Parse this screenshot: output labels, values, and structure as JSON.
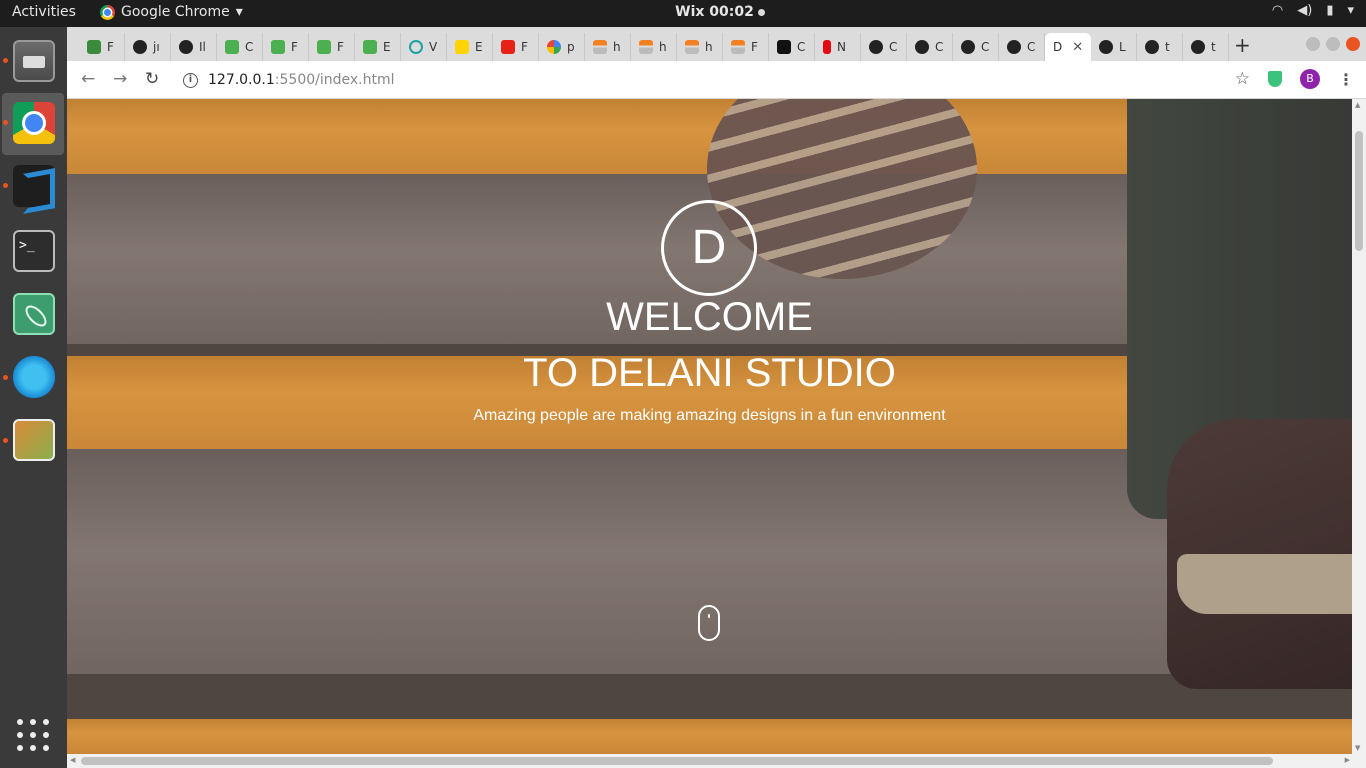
{
  "topbar": {
    "activities": "Activities",
    "app_name": "Google Chrome",
    "app_caret": "▾",
    "clock": "Wix 00:02"
  },
  "browser": {
    "tabs": [
      {
        "title": "F",
        "favicon": "green-leaf-icon"
      },
      {
        "title": "jı",
        "favicon": "github-icon"
      },
      {
        "title": "Il",
        "favicon": "github-icon"
      },
      {
        "title": "C",
        "favicon": "w3schools-icon"
      },
      {
        "title": "F",
        "favicon": "w3schools-icon"
      },
      {
        "title": "F",
        "favicon": "w3schools-icon"
      },
      {
        "title": "E",
        "favicon": "w3schools-icon"
      },
      {
        "title": "V",
        "favicon": "ring-icon"
      },
      {
        "title": "E",
        "favicon": "yellow-app-icon"
      },
      {
        "title": "F",
        "favicon": "youtube-icon"
      },
      {
        "title": "p",
        "favicon": "google-icon"
      },
      {
        "title": "h",
        "favicon": "stackoverflow-icon"
      },
      {
        "title": "h",
        "favicon": "stackoverflow-icon"
      },
      {
        "title": "h",
        "favicon": "stackoverflow-icon"
      },
      {
        "title": "F",
        "favicon": "stackoverflow-icon"
      },
      {
        "title": "C",
        "favicon": "codepen-icon"
      },
      {
        "title": "N",
        "favicon": "netflix-icon"
      },
      {
        "title": "C",
        "favicon": "github-icon"
      },
      {
        "title": "C",
        "favicon": "github-icon"
      },
      {
        "title": "C",
        "favicon": "github-icon"
      },
      {
        "title": "C",
        "favicon": "github-icon"
      },
      {
        "title": "D",
        "favicon": "delani-icon",
        "active": true
      },
      {
        "title": "L",
        "favicon": "github-icon"
      },
      {
        "title": "t",
        "favicon": "github-icon"
      },
      {
        "title": "t",
        "favicon": "github-icon"
      }
    ],
    "new_tab": "+",
    "url_host": "127.0.0.1",
    "url_path": ":5500/index.html",
    "profile_initial": "B"
  },
  "page": {
    "logo_letter": "D",
    "heading_line1": "WELCOME",
    "heading_line2": "TO DELANI STUDIO",
    "subtitle": "Amazing people are making amazing designs in a fun environment"
  },
  "colors": {
    "stripe_orange": "#f3a93f",
    "stair_gray": "#8d857b",
    "hero_text": "#ffffff",
    "ubuntu_accent": "#e95420"
  }
}
